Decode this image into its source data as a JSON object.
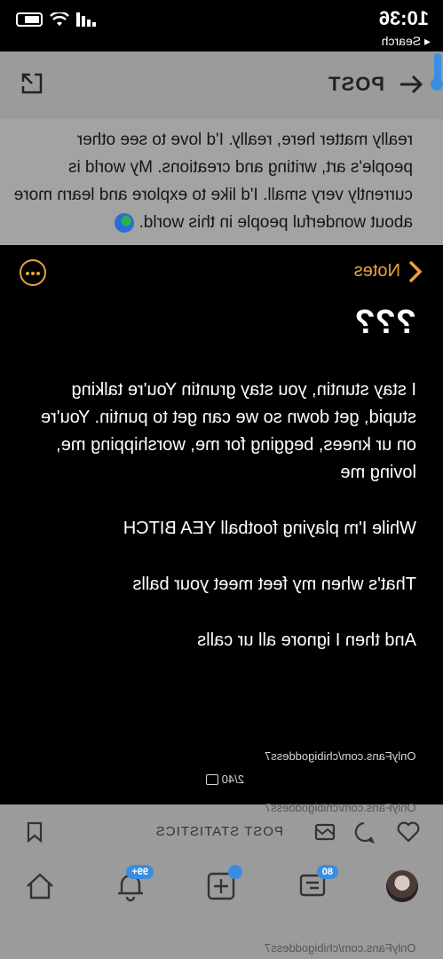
{
  "status_bar": {
    "time": "10:36",
    "back_label": "◂ Search"
  },
  "header": {
    "title": "POST"
  },
  "bio": {
    "text": "really matter here, really. I'd love to see other people's art, writing and creations. My world is currently very small. I'd like to explore and learn more about wonderful people in this world."
  },
  "notes": {
    "back_label": "Notes",
    "heading": "???",
    "paragraphs": [
      "I stay stuntin, you stay gruntin You're talking stupid, get down so we can get to puntin. You're on ur knees, begging for me, worshipping me, loving me",
      "While I'm playing football YEA BITCH",
      "That's when my feet meet your balls",
      "And then I ignore all ur calls"
    ],
    "watermark": "OnlyFans.com/chibigoddess7",
    "image_count": "2/40"
  },
  "post_actions": {
    "watermark": "OnlyFans.com/chibigoddess7",
    "stats_label": "POST STATISTICS"
  },
  "bottom_nav": {
    "notifications_badge": "99+",
    "messages_badge": "80",
    "watermark": "OnlyFans.com/chibigoddess7"
  },
  "colors": {
    "accent": "#e8a33c",
    "badge": "#3a8de0",
    "overlay_grey": "#9b9b9b"
  }
}
